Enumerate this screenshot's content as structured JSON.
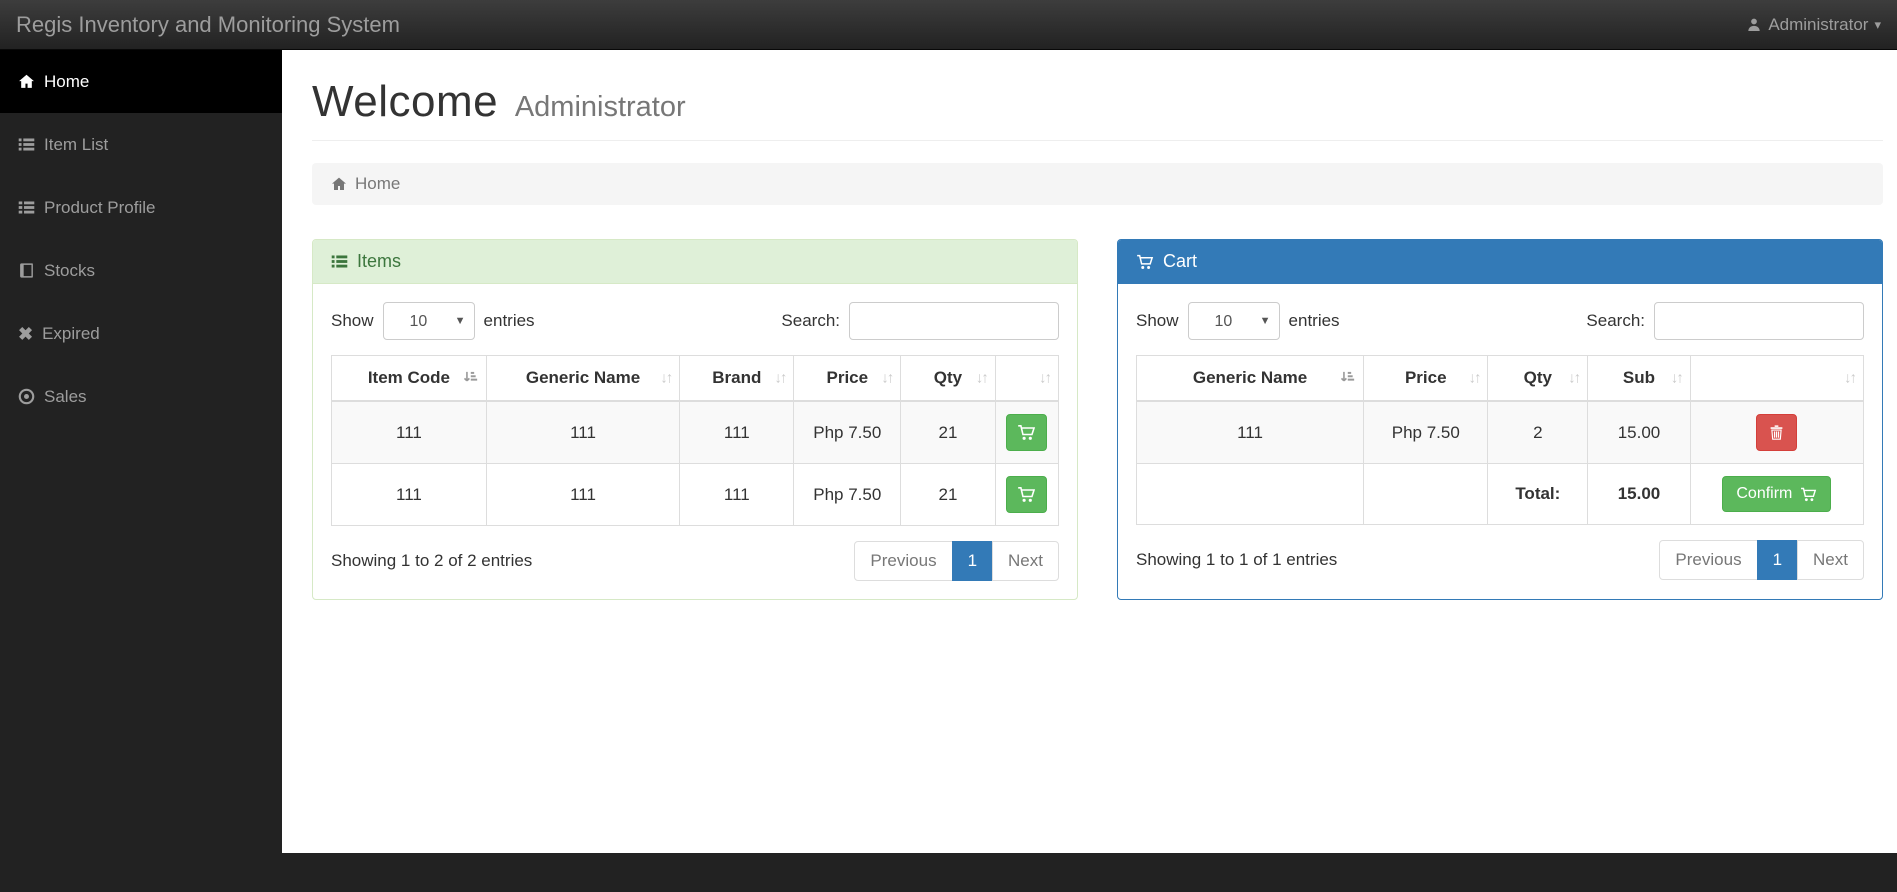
{
  "navbar": {
    "brand": "Regis Inventory and Monitoring System",
    "user_label": "Administrator",
    "icons": {
      "user": "user-icon",
      "caret": "caret-down-icon"
    }
  },
  "sidebar": {
    "items": [
      {
        "label": "Home",
        "icon": "home-icon",
        "active": true
      },
      {
        "label": "Item List",
        "icon": "list-icon",
        "active": false
      },
      {
        "label": "Product Profile",
        "icon": "list-alt-icon",
        "active": false
      },
      {
        "label": "Stocks",
        "icon": "book-icon",
        "active": false
      },
      {
        "label": "Expired",
        "icon": "remove-icon",
        "active": false
      },
      {
        "label": "Sales",
        "icon": "dot-circle-icon",
        "active": false
      }
    ]
  },
  "page": {
    "title": "Welcome",
    "subtitle": "Administrator",
    "breadcrumb_home": "Home"
  },
  "items_panel": {
    "title": "Items",
    "icon": "list-icon",
    "show_label": "Show",
    "page_size": "10",
    "entries_label": "entries",
    "search_label": "Search:",
    "search_value": "",
    "columns": [
      "Item Code",
      "Generic Name",
      "Brand",
      "Price",
      "Qty"
    ],
    "rows": [
      [
        "111",
        "111",
        "111",
        "Php 7.50",
        "21"
      ],
      [
        "111",
        "111",
        "111",
        "Php 7.50",
        "21"
      ]
    ],
    "row_action_icon": "cart-icon",
    "info": "Showing 1 to 2 of 2 entries",
    "pagination": {
      "previous": "Previous",
      "page": "1",
      "next": "Next"
    }
  },
  "cart_panel": {
    "title": "Cart",
    "icon": "cart-icon",
    "show_label": "Show",
    "page_size": "10",
    "entries_label": "entries",
    "search_label": "Search:",
    "search_value": "",
    "columns": [
      "Generic Name",
      "Price",
      "Qty",
      "Sub"
    ],
    "rows": [
      [
        "111",
        "Php 7.50",
        "2",
        "15.00"
      ]
    ],
    "row_action_icon": "trash-icon",
    "total_label": "Total:",
    "total_value": "15.00",
    "confirm_label": "Confirm",
    "confirm_icon": "cart-icon",
    "info": "Showing 1 to 1 of 1 entries",
    "pagination": {
      "previous": "Previous",
      "page": "1",
      "next": "Next"
    }
  },
  "colors": {
    "accent_blue": "#337ab7",
    "success_green": "#5cb85c",
    "success_border": "#4cae4c",
    "danger_red": "#d9534f",
    "panel_success_bg": "#dff0d8",
    "panel_success_text": "#3c763d",
    "navbar_dark": "#222",
    "sidebar_dark": "#222",
    "active_item": "#000"
  }
}
